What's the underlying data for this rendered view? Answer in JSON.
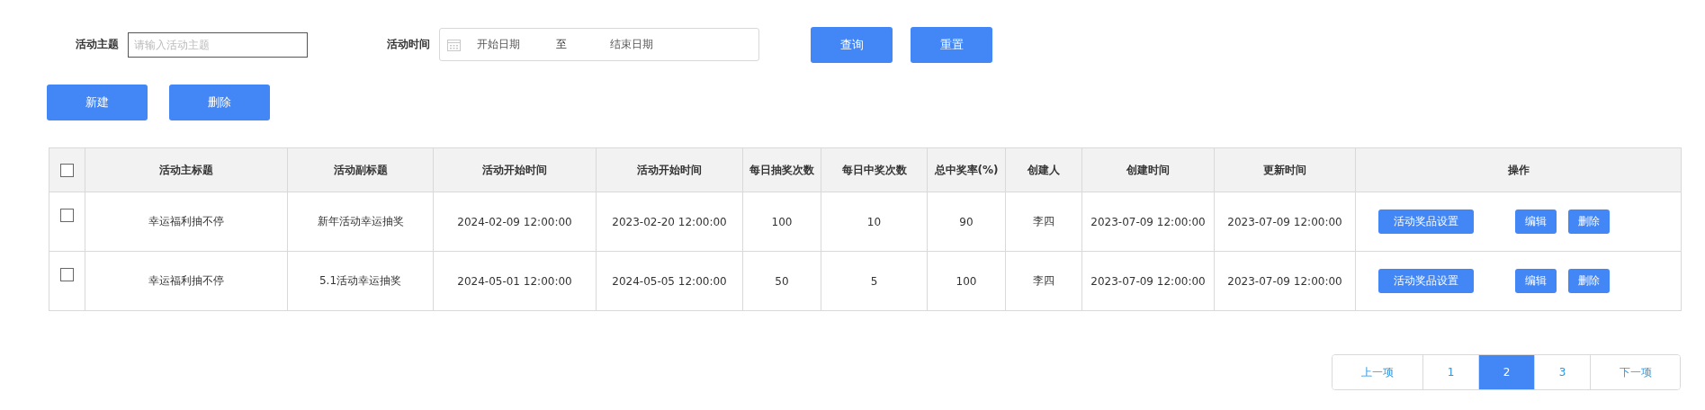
{
  "filters": [
    {
      "kind": "text",
      "label": "活动主题",
      "placeholder": "请输入活动主题"
    },
    {
      "kind": "daterange",
      "label": "活动时间",
      "start_placeholder": "开始日期",
      "separator": "至",
      "end_placeholder": "结束日期"
    }
  ],
  "filter_buttons": [
    "查询",
    "重置"
  ],
  "actions": [
    "新建",
    "删除"
  ],
  "table": {
    "select_all_checked": false,
    "columns": [
      "活动主标题",
      "活动副标题",
      "活动开始时间",
      "活动开始时间",
      "每日抽奖次数",
      "每日中奖次数",
      "总中奖率(%)",
      "创建人",
      "创建时间",
      "更新时间",
      "操作"
    ],
    "rows": [
      {
        "checked": false,
        "cells": [
          "幸运福利抽不停",
          "新年活动幸运抽奖",
          "2024-02-09 12:00:00",
          "2023-02-20 12:00:00",
          "100",
          "10",
          "90",
          "李四",
          "2023-07-09 12:00:00",
          "2023-07-09 12:00:00"
        ],
        "operations": [
          "活动奖品设置",
          "编辑",
          "删除"
        ]
      },
      {
        "checked": false,
        "cells": [
          "幸运福利抽不停",
          "5.1活动幸运抽奖",
          "2024-05-01 12:00:00",
          "2024-05-05 12:00:00",
          "50",
          "5",
          "100",
          "李四",
          "2023-07-09 12:00:00",
          "2023-07-09 12:00:00"
        ],
        "operations": [
          "活动奖品设置",
          "编辑",
          "删除"
        ]
      }
    ]
  },
  "pagination": [
    {
      "label": "上一项",
      "selected": false
    },
    {
      "label": "1",
      "selected": false
    },
    {
      "label": "2",
      "selected": true
    },
    {
      "label": "3",
      "selected": false
    },
    {
      "label": "下一项",
      "selected": false
    }
  ]
}
